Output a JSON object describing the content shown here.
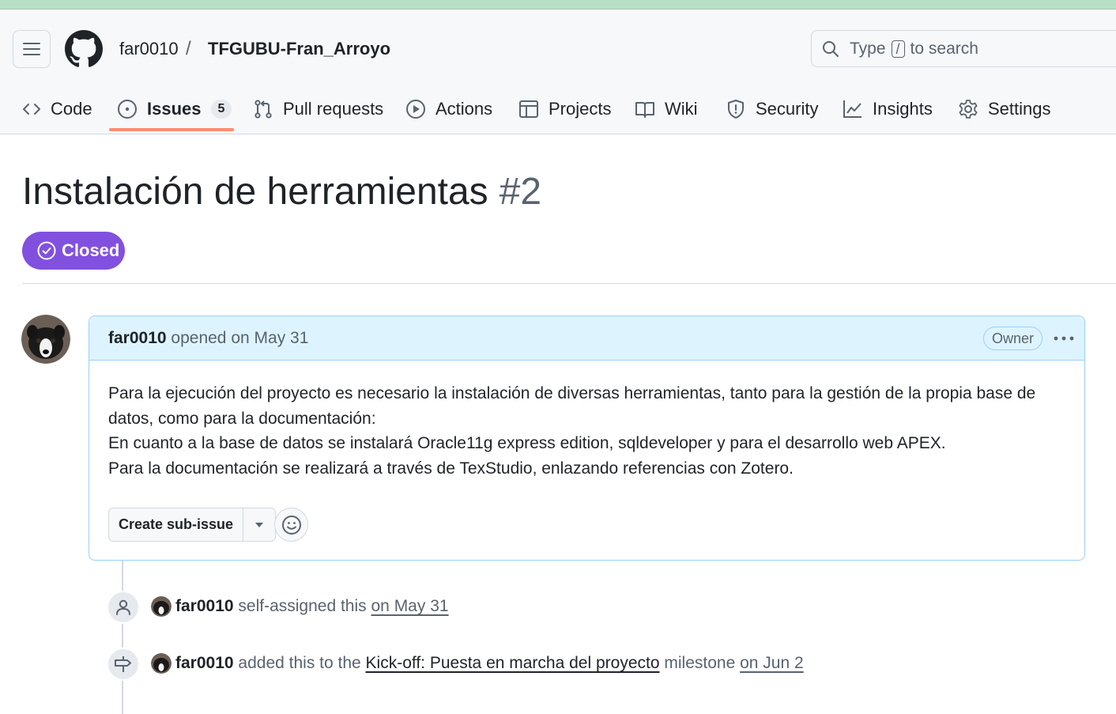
{
  "colors": {
    "closed_badge": "#8250df",
    "tab_underline": "#fd8c73",
    "comment_header_bg": "#ddf4ff",
    "comment_border": "#9ccffc"
  },
  "header": {
    "owner": "far0010",
    "separator": "/",
    "repo": "TFGUBU-Fran_Arroyo",
    "search": {
      "prefix": "Type",
      "key": "/",
      "suffix": "to search"
    }
  },
  "tabs": [
    {
      "label": "Code",
      "icon": "code-icon"
    },
    {
      "label": "Issues",
      "icon": "issue-opened-icon",
      "count": "5",
      "selected": true
    },
    {
      "label": "Pull requests",
      "icon": "git-pull-request-icon"
    },
    {
      "label": "Actions",
      "icon": "play-icon"
    },
    {
      "label": "Projects",
      "icon": "table-icon"
    },
    {
      "label": "Wiki",
      "icon": "book-icon"
    },
    {
      "label": "Security",
      "icon": "shield-icon"
    },
    {
      "label": "Insights",
      "icon": "graph-icon"
    },
    {
      "label": "Settings",
      "icon": "gear-icon"
    }
  ],
  "issue": {
    "title": "Instalación de herramientas",
    "number": "#2",
    "state": "Closed"
  },
  "comment": {
    "author": "far0010",
    "action": "opened",
    "date": "on May 31",
    "role_badge": "Owner",
    "body": [
      "Para la ejecución del proyecto es necesario la instalación de diversas herramientas, tanto para la gestión de la propia base de datos, como para la documentación:",
      "En cuanto a la base de datos se instalará Oracle11g express edition, sqldeveloper y para el desarrollo web APEX.",
      "Para la documentación se realizará a través de TexStudio, enlazando referencias con Zotero."
    ],
    "create_subissue_label": "Create sub-issue"
  },
  "timeline": [
    {
      "icon": "person-icon",
      "actor": "far0010",
      "text": "self-assigned this",
      "date": "on May 31"
    },
    {
      "icon": "milestone-icon",
      "actor": "far0010",
      "text_before": "added this to the",
      "milestone": "Kick-off: Puesta en marcha del proyecto",
      "text_after": "milestone",
      "date": "on Jun 2"
    }
  ]
}
